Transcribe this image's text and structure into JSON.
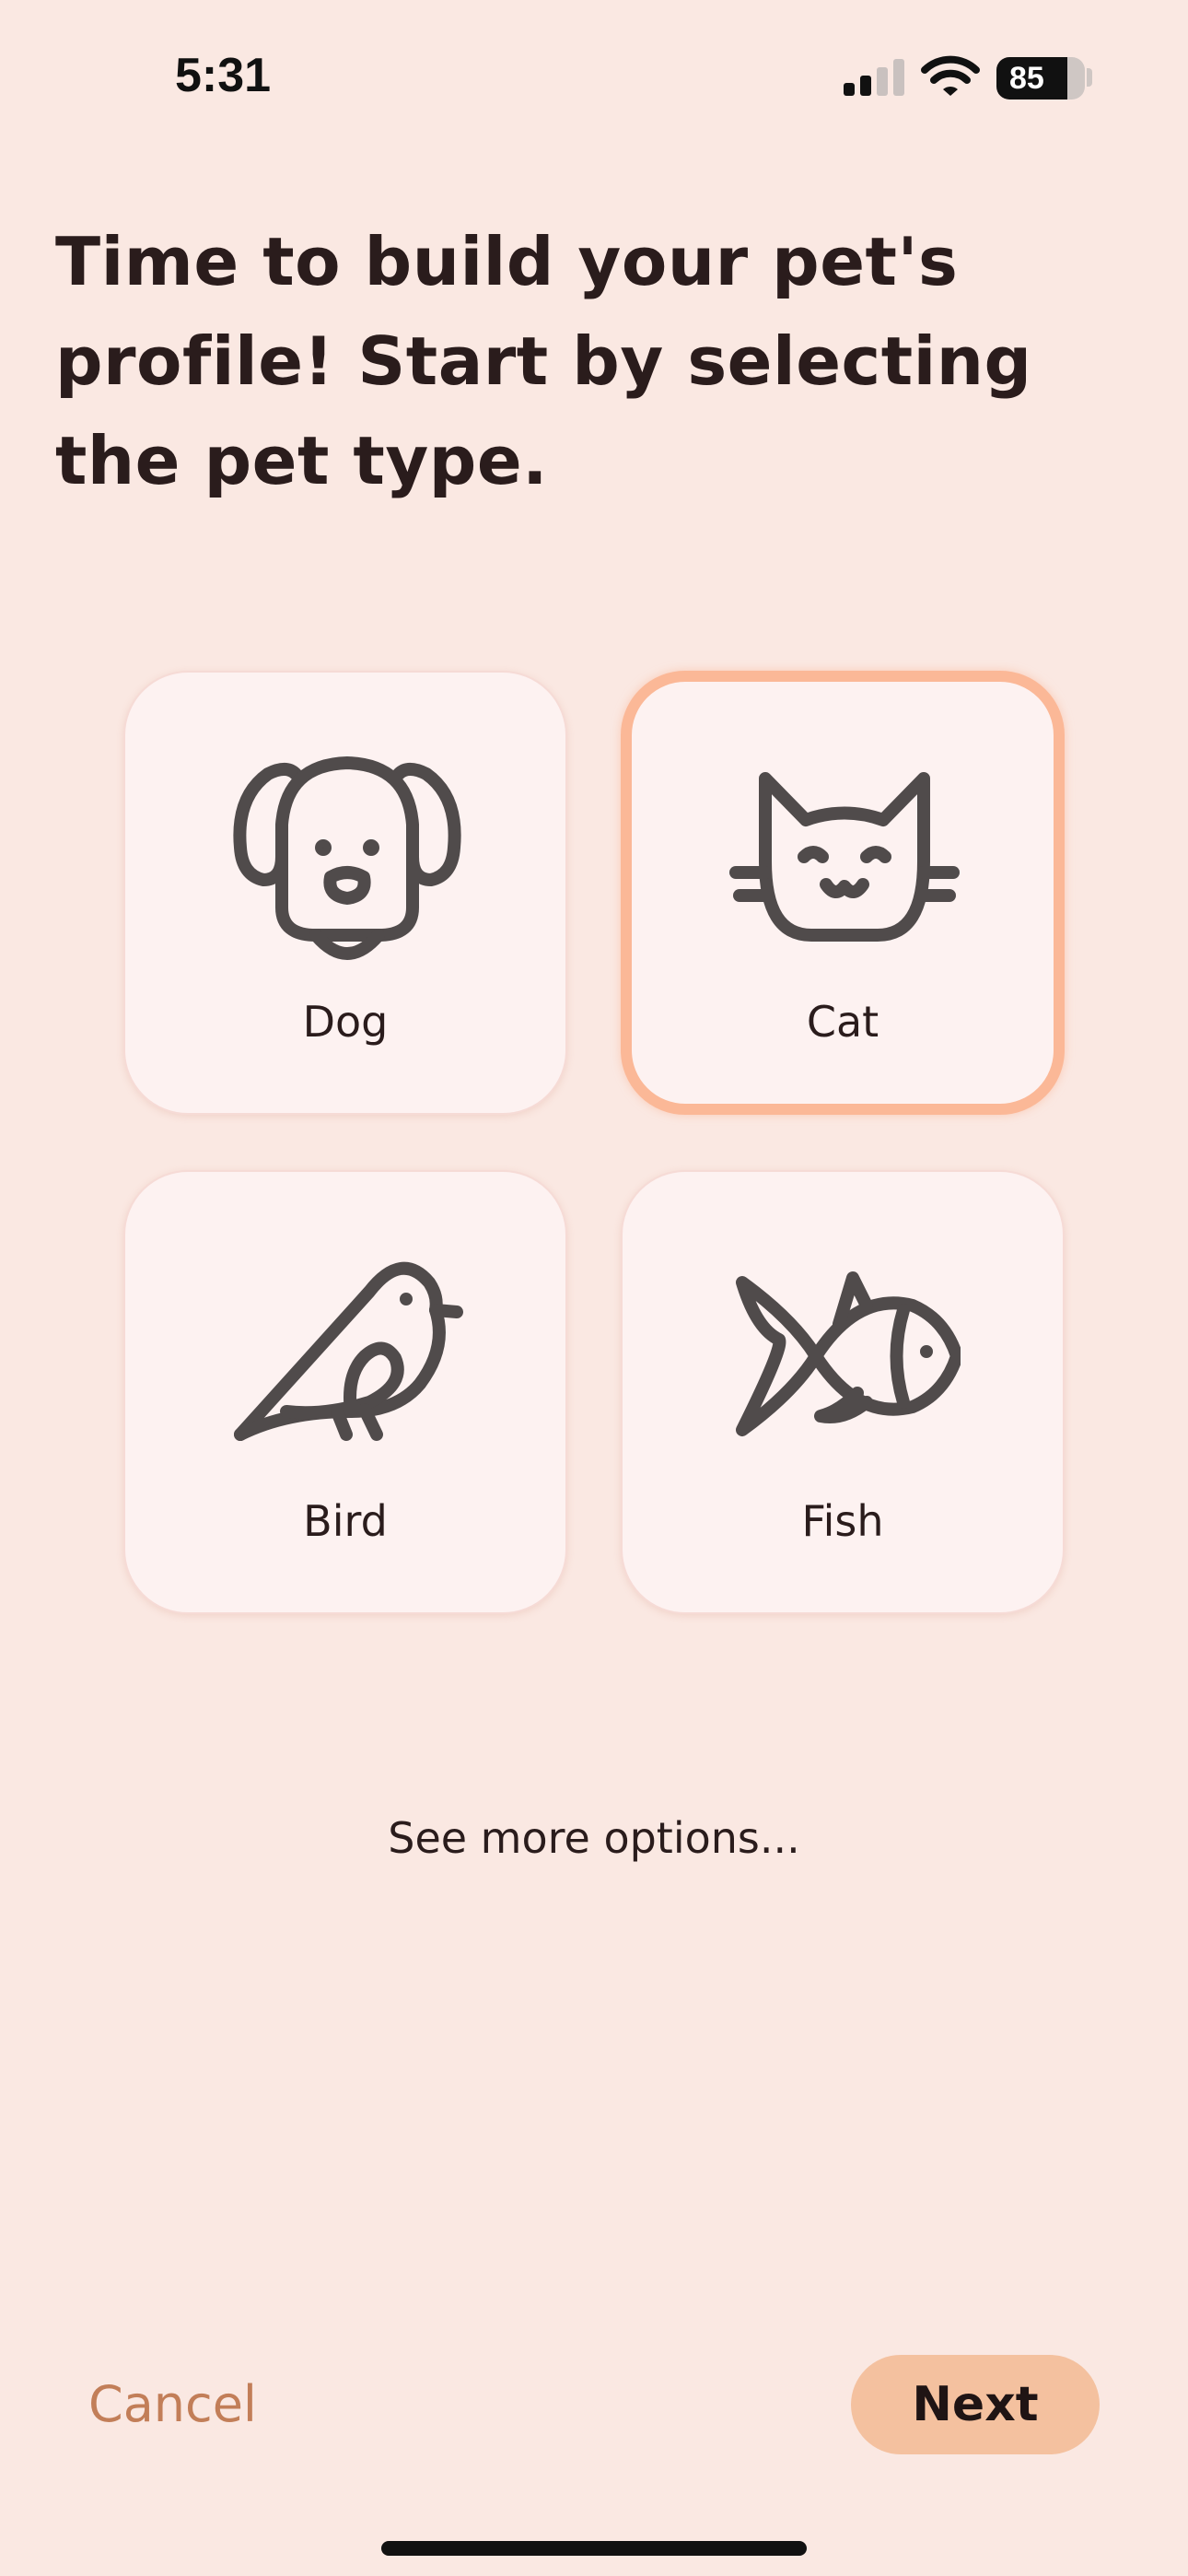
{
  "status_bar": {
    "time": "5:31",
    "battery": "85",
    "icons": [
      "signal-icon",
      "wifi-icon",
      "battery-icon"
    ]
  },
  "heading": "Time to build your pet's profile! Start by selecting the pet type.",
  "pet_types": [
    {
      "label": "Dog",
      "icon": "dog-icon",
      "selected": false
    },
    {
      "label": "Cat",
      "icon": "cat-icon",
      "selected": true
    },
    {
      "label": "Bird",
      "icon": "bird-icon",
      "selected": false
    },
    {
      "label": "Fish",
      "icon": "fish-icon",
      "selected": false
    }
  ],
  "see_more": "See more options...",
  "footer": {
    "cancel_label": "Cancel",
    "next_label": "Next"
  },
  "colors": {
    "background": "#fae8e2",
    "card": "#fdf2f1",
    "selected_border": "#fbb897",
    "cancel_text": "#c27e58",
    "next_button": "#f4c19f"
  }
}
